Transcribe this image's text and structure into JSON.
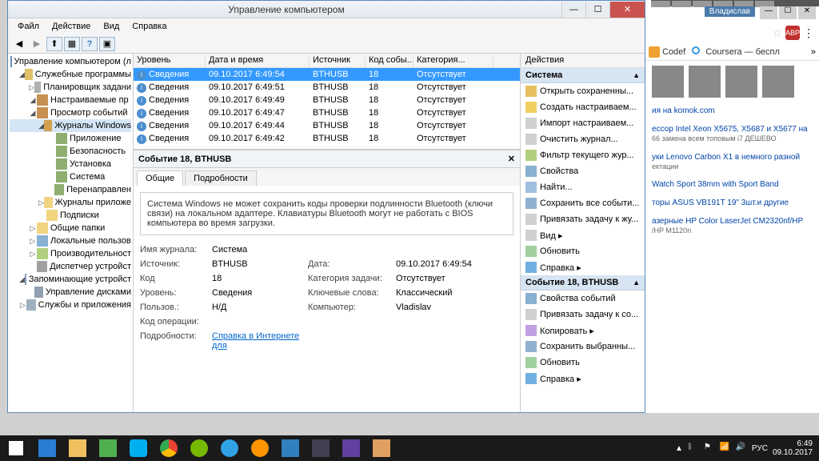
{
  "window": {
    "title": "Управление компьютером",
    "menus": [
      "Файл",
      "Действие",
      "Вид",
      "Справка"
    ]
  },
  "tree": [
    {
      "ind": 1,
      "tw": "",
      "icon": "icn-comp",
      "label": "Управление компьютером (л"
    },
    {
      "ind": 2,
      "tw": "◢",
      "icon": "icn-tools",
      "label": "Служебные программы"
    },
    {
      "ind": 3,
      "tw": "▷",
      "icon": "icn-sched",
      "label": "Планировщик задани"
    },
    {
      "ind": 3,
      "tw": "◢",
      "icon": "icn-event",
      "label": "Настраиваемые пр"
    },
    {
      "ind": 3,
      "tw": "◢",
      "icon": "icn-event",
      "label": "Просмотр событий"
    },
    {
      "ind": 4,
      "tw": "◢",
      "icon": "icn-win",
      "label": "Журналы Windows",
      "sel": true
    },
    {
      "ind": 5,
      "tw": "",
      "icon": "icn-log",
      "label": "Приложение"
    },
    {
      "ind": 5,
      "tw": "",
      "icon": "icn-log",
      "label": "Безопасность"
    },
    {
      "ind": 5,
      "tw": "",
      "icon": "icn-log",
      "label": "Установка"
    },
    {
      "ind": 5,
      "tw": "",
      "icon": "icn-log",
      "label": "Система"
    },
    {
      "ind": 5,
      "tw": "",
      "icon": "icn-log",
      "label": "Перенаправлен"
    },
    {
      "ind": 4,
      "tw": "▷",
      "icon": "icn-folder",
      "label": "Журналы приложе"
    },
    {
      "ind": 4,
      "tw": "",
      "icon": "icn-folder",
      "label": "Подписки"
    },
    {
      "ind": 3,
      "tw": "▷",
      "icon": "icn-folder",
      "label": "Общие папки"
    },
    {
      "ind": 3,
      "tw": "▷",
      "icon": "icn-users",
      "label": "Локальные пользов"
    },
    {
      "ind": 3,
      "tw": "▷",
      "icon": "icn-perf",
      "label": "Производительност"
    },
    {
      "ind": 3,
      "tw": "",
      "icon": "icn-dev",
      "label": "Диспетчер устройст"
    },
    {
      "ind": 2,
      "tw": "◢",
      "icon": "icn-storage",
      "label": "Запоминающие устройст"
    },
    {
      "ind": 3,
      "tw": "",
      "icon": "icn-disk",
      "label": "Управление дисками"
    },
    {
      "ind": 2,
      "tw": "▷",
      "icon": "icn-svc",
      "label": "Службы и приложения"
    }
  ],
  "grid": {
    "headers": [
      "Уровень",
      "Дата и время",
      "Источник",
      "Код собы...",
      "Категория..."
    ],
    "widths": [
      90,
      130,
      70,
      60,
      100
    ],
    "rows": [
      {
        "level": "Сведения",
        "date": "09.10.2017 6:49:54",
        "src": "BTHUSB",
        "code": "18",
        "cat": "Отсутствует",
        "sel": true
      },
      {
        "level": "Сведения",
        "date": "09.10.2017 6:49:51",
        "src": "BTHUSB",
        "code": "18",
        "cat": "Отсутствует"
      },
      {
        "level": "Сведения",
        "date": "09.10.2017 6:49:49",
        "src": "BTHUSB",
        "code": "18",
        "cat": "Отсутствует"
      },
      {
        "level": "Сведения",
        "date": "09.10.2017 6:49:47",
        "src": "BTHUSB",
        "code": "18",
        "cat": "Отсутствует"
      },
      {
        "level": "Сведения",
        "date": "09.10.2017 6:49:44",
        "src": "BTHUSB",
        "code": "18",
        "cat": "Отсутствует"
      },
      {
        "level": "Сведения",
        "date": "09.10.2017 6:49:42",
        "src": "BTHUSB",
        "code": "18",
        "cat": "Отсутствует"
      }
    ]
  },
  "detail": {
    "title": "Событие 18, BTHUSB",
    "tabs": [
      "Общие",
      "Подробности"
    ],
    "message": "Система Windows не может сохранить коды проверки подлинности Bluetooth (ключи связи) на локальном адаптере. Клавиатуры Bluetooth могут не работать с BIOS компьютера во время загрузки.",
    "props": {
      "logname_k": "Имя журнала:",
      "logname_v": "Система",
      "source_k": "Источник:",
      "source_v": "BTHUSB",
      "date_k": "Дата:",
      "date_v": "09.10.2017 6:49:54",
      "code_k": "Код",
      "code_v": "18",
      "taskcat_k": "Категория задачи:",
      "taskcat_v": "Отсутствует",
      "level_k": "Уровень:",
      "level_v": "Сведения",
      "keywords_k": "Ключевые слова:",
      "keywords_v": "Классический",
      "user_k": "Пользов.:",
      "user_v": "Н/Д",
      "computer_k": "Компьютер:",
      "computer_v": "Vladislav",
      "opcode_k": "Код операции:",
      "opcode_v": "",
      "details_k": "Подробности:",
      "details_link": "Справка в Интернете для"
    }
  },
  "actions": {
    "header": "Действия",
    "sec1": "Система",
    "items1": [
      {
        "i": "ai1",
        "t": "Открыть сохраненны..."
      },
      {
        "i": "ai2",
        "t": "Создать настраиваем..."
      },
      {
        "i": "ai3",
        "t": "Импорт настраиваем..."
      },
      {
        "i": "ai3",
        "t": "Очистить журнал..."
      },
      {
        "i": "ai4",
        "t": "Фильтр текущего жур..."
      },
      {
        "i": "ai5",
        "t": "Свойства"
      },
      {
        "i": "ai6",
        "t": "Найти..."
      },
      {
        "i": "ai7",
        "t": "Сохранить все событи..."
      },
      {
        "i": "ai3",
        "t": "Привязать задачу к жу..."
      },
      {
        "i": "ai3",
        "t": "Вид                                       ▸"
      },
      {
        "i": "ai11",
        "t": "Обновить"
      },
      {
        "i": "ai10",
        "t": "Справка                               ▸"
      }
    ],
    "sec2": "Событие 18, BTHUSB",
    "items2": [
      {
        "i": "ai5",
        "t": "Свойства событий"
      },
      {
        "i": "ai3",
        "t": "Привязать задачу к со..."
      },
      {
        "i": "ai8",
        "t": "Копировать                        ▸"
      },
      {
        "i": "ai7",
        "t": "Сохранить выбранны..."
      },
      {
        "i": "ai11",
        "t": "Обновить"
      },
      {
        "i": "ai10",
        "t": "Справка                               ▸"
      }
    ]
  },
  "browser": {
    "user": "Владислав",
    "bookmarks": [
      {
        "icon": "bm-cf",
        "t": "Codef"
      },
      {
        "icon": "bm-co",
        "t": "Coursera — беспл"
      }
    ],
    "listings": [
      {
        "t": "ия на komok.com",
        "s": ""
      },
      {
        "t": "ессор Intel Xeon X5675, X5687 и X5677 на",
        "s": "66 замена всем топовым i7 ДЕШЕВО"
      },
      {
        "t": "уки Lenovo Carbon X1 в немного разной",
        "s": "ектации"
      },
      {
        "t": "Watch Sport 38mm with Sport Band",
        "s": ""
      },
      {
        "t": "торы ASUS VB191T 19\" 3шт.и другие",
        "s": ""
      },
      {
        "t": "азерные HP Color LaserJet CM2320nf/HP",
        "s": "/HP M1120n"
      }
    ]
  },
  "taskbar": {
    "lang": "РУС",
    "time": "6:49",
    "date": "09.10.2017"
  }
}
